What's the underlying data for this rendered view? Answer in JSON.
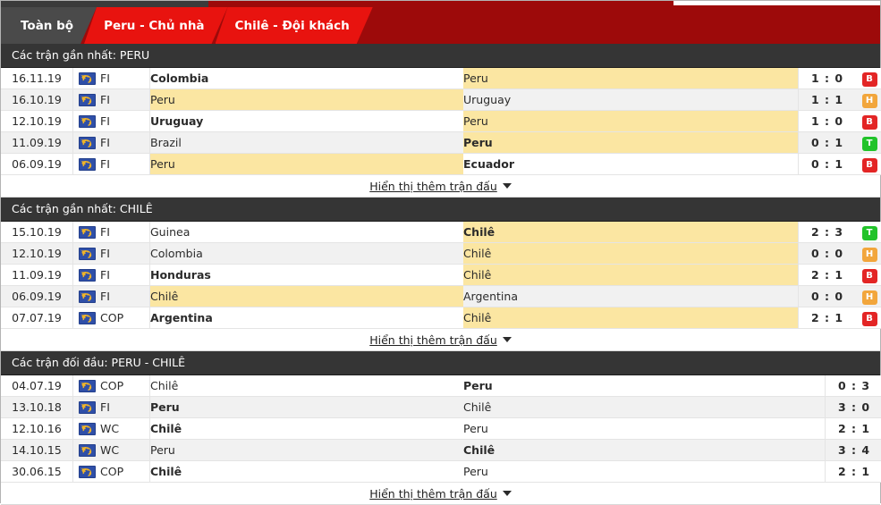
{
  "tabs": [
    {
      "label": "Toàn bộ",
      "active": true
    },
    {
      "label": "Peru - Chủ nhà",
      "active": false
    },
    {
      "label": "Chilê - Đội khách",
      "active": false
    }
  ],
  "colors": {
    "brand_red": "#9d0a0a",
    "tab_red": "#e8130f",
    "tab_active": "#4a4a4a",
    "section_header": "#353535",
    "highlight_row": "#fbe6a2",
    "badge_loss": "#e32525",
    "badge_draw": "#f2a63c",
    "badge_win": "#22c32a"
  },
  "icons": {
    "globe": "world-globe-icon",
    "caret": "chevron-down-icon"
  },
  "show_more_label": "Hiển thị thêm trận đấu",
  "sections": [
    {
      "title": "Các trận gần nhất: PERU",
      "has_badges": true,
      "rows": [
        {
          "date": "16.11.19",
          "comp": "FI",
          "home": "Colombia",
          "home_bold": true,
          "home_hl": false,
          "away": "Peru",
          "away_bold": false,
          "away_hl": true,
          "score": "1 : 0",
          "badge": "B"
        },
        {
          "date": "16.10.19",
          "comp": "FI",
          "home": "Peru",
          "home_bold": false,
          "home_hl": true,
          "away": "Uruguay",
          "away_bold": false,
          "away_hl": false,
          "score": "1 : 1",
          "badge": "H"
        },
        {
          "date": "12.10.19",
          "comp": "FI",
          "home": "Uruguay",
          "home_bold": true,
          "home_hl": false,
          "away": "Peru",
          "away_bold": false,
          "away_hl": true,
          "score": "1 : 0",
          "badge": "B"
        },
        {
          "date": "11.09.19",
          "comp": "FI",
          "home": "Brazil",
          "home_bold": false,
          "home_hl": false,
          "away": "Peru",
          "away_bold": true,
          "away_hl": true,
          "score": "0 : 1",
          "badge": "T"
        },
        {
          "date": "06.09.19",
          "comp": "FI",
          "home": "Peru",
          "home_bold": false,
          "home_hl": true,
          "away": "Ecuador",
          "away_bold": true,
          "away_hl": false,
          "score": "0 : 1",
          "badge": "B"
        }
      ]
    },
    {
      "title": "Các trận gần nhất: CHILÊ",
      "has_badges": true,
      "rows": [
        {
          "date": "15.10.19",
          "comp": "FI",
          "home": "Guinea",
          "home_bold": false,
          "home_hl": false,
          "away": "Chilê",
          "away_bold": true,
          "away_hl": true,
          "score": "2 : 3",
          "badge": "T"
        },
        {
          "date": "12.10.19",
          "comp": "FI",
          "home": "Colombia",
          "home_bold": false,
          "home_hl": false,
          "away": "Chilê",
          "away_bold": false,
          "away_hl": true,
          "score": "0 : 0",
          "badge": "H"
        },
        {
          "date": "11.09.19",
          "comp": "FI",
          "home": "Honduras",
          "home_bold": true,
          "home_hl": false,
          "away": "Chilê",
          "away_bold": false,
          "away_hl": true,
          "score": "2 : 1",
          "badge": "B"
        },
        {
          "date": "06.09.19",
          "comp": "FI",
          "home": "Chilê",
          "home_bold": false,
          "home_hl": true,
          "away": "Argentina",
          "away_bold": false,
          "away_hl": false,
          "score": "0 : 0",
          "badge": "H"
        },
        {
          "date": "07.07.19",
          "comp": "COP",
          "home": "Argentina",
          "home_bold": true,
          "home_hl": false,
          "away": "Chilê",
          "away_bold": false,
          "away_hl": true,
          "score": "2 : 1",
          "badge": "B"
        }
      ]
    },
    {
      "title": "Các trận đối đầu: PERU - CHILÊ",
      "has_badges": false,
      "rows": [
        {
          "date": "04.07.19",
          "comp": "COP",
          "home": "Chilê",
          "home_bold": false,
          "home_hl": false,
          "away": "Peru",
          "away_bold": true,
          "away_hl": false,
          "score": "0 : 3",
          "badge": ""
        },
        {
          "date": "13.10.18",
          "comp": "FI",
          "home": "Peru",
          "home_bold": true,
          "home_hl": false,
          "away": "Chilê",
          "away_bold": false,
          "away_hl": false,
          "score": "3 : 0",
          "badge": ""
        },
        {
          "date": "12.10.16",
          "comp": "WC",
          "home": "Chilê",
          "home_bold": true,
          "home_hl": false,
          "away": "Peru",
          "away_bold": false,
          "away_hl": false,
          "score": "2 : 1",
          "badge": ""
        },
        {
          "date": "14.10.15",
          "comp": "WC",
          "home": "Peru",
          "home_bold": false,
          "home_hl": false,
          "away": "Chilê",
          "away_bold": true,
          "away_hl": false,
          "score": "3 : 4",
          "badge": ""
        },
        {
          "date": "30.06.15",
          "comp": "COP",
          "home": "Chilê",
          "home_bold": true,
          "home_hl": false,
          "away": "Peru",
          "away_bold": false,
          "away_hl": false,
          "score": "2 : 1",
          "badge": ""
        }
      ]
    }
  ]
}
